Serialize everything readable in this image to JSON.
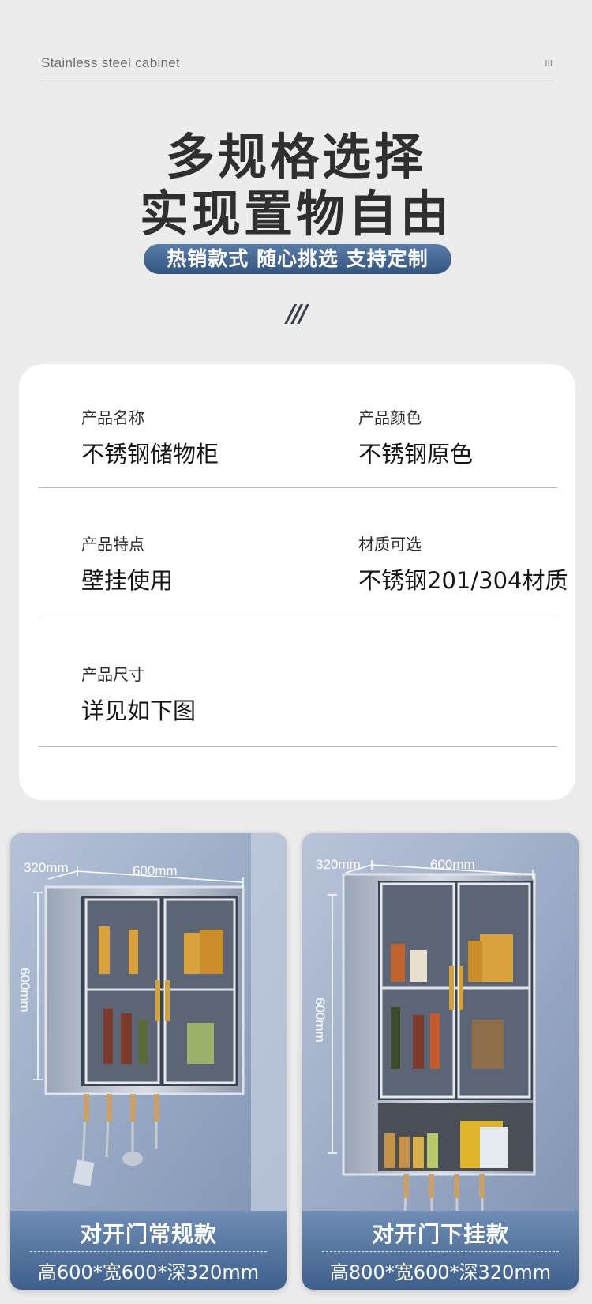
{
  "header": {
    "brand": "Stainless steel cabinet",
    "mark": "III",
    "headline_line1": "多规格选择",
    "headline_line2": "实现置物自由",
    "tagline": "热销款式 随心挑选 支持定制",
    "decor": "///"
  },
  "specs": [
    {
      "label": "产品名称",
      "value": "不锈钢储物柜"
    },
    {
      "label": "产品颜色",
      "value": "不锈钢原色"
    },
    {
      "label": "产品特点",
      "value": "壁挂使用"
    },
    {
      "label": "材质可选",
      "value": "不锈钢201/304材质"
    },
    {
      "label": "产品尺寸",
      "value": "详见如下图"
    }
  ],
  "products": [
    {
      "depth_label": "320mm",
      "width_label": "600mm",
      "height_label": "600mm",
      "title": "对开门常规款",
      "size": "高600*宽600*深320mm"
    },
    {
      "depth_label": "320mm",
      "width_label": "600mm",
      "height_label": "600mm",
      "title": "对开门下挂款",
      "size": "高800*宽600*深320mm"
    }
  ],
  "colors": {
    "accent": "#3e5f8b",
    "background": "#ececec",
    "card": "#ffffff"
  }
}
